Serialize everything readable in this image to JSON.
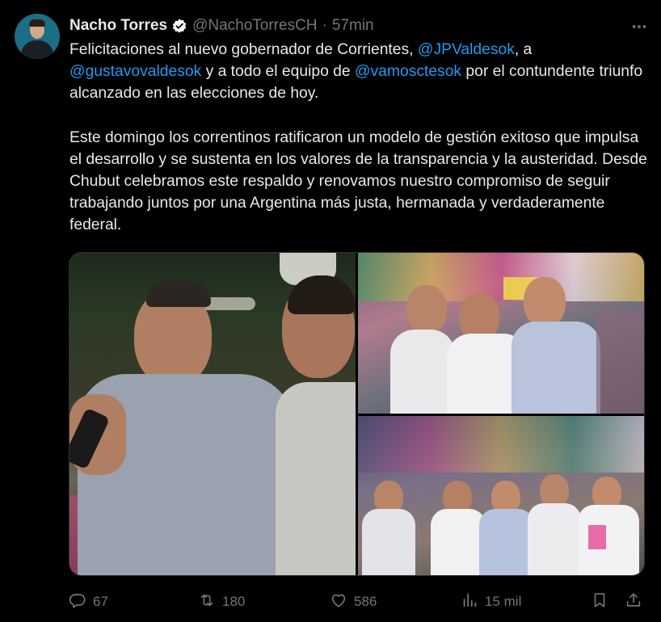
{
  "author": {
    "name": "Nacho Torres",
    "handle": "@NachoTorresCH",
    "separator": "·",
    "time": "57min"
  },
  "tweet": {
    "p1_a": "Felicitaciones al nuevo gobernador de Corrientes, ",
    "mention1": "@JPValdesok",
    "p1_b": ", a",
    "mention2": "@gustavovaldesok",
    "p1_c": " y a todo el equipo de ",
    "mention3": "@vamosctesok",
    "p1_d": " por el contundente triunfo alcanzado en las elecciones de hoy.",
    "p2": "Este domingo los correntinos ratificaron un modelo de gestión exitoso que impulsa el desarrollo y se sustenta en los valores de la transparencia y la austeridad. Desde Chubut celebramos este respaldo y renovamos nuestro compromiso de seguir trabajando juntos por una Argentina más justa, hermanada y verdaderamente federal."
  },
  "actions": {
    "replies": "67",
    "reposts": "180",
    "likes": "586",
    "views": "15 mil"
  },
  "icons": {
    "verified": "verified-badge-icon",
    "more": "more-icon",
    "reply": "reply-icon",
    "repost": "repost-icon",
    "like": "like-icon",
    "views": "views-icon",
    "bookmark": "bookmark-icon",
    "share": "share-icon"
  },
  "colors": {
    "background": "#000000",
    "text": "#e7e9ea",
    "secondary": "#71767b",
    "link": "#1d9bf0"
  }
}
